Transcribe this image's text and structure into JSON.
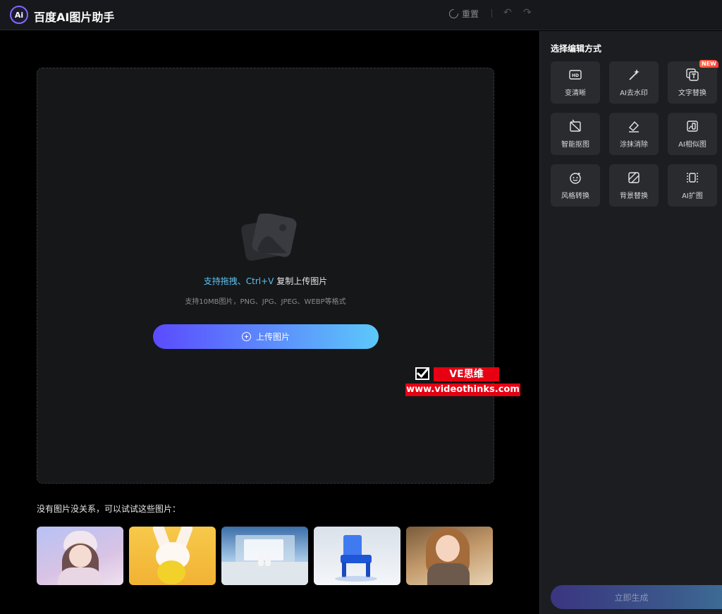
{
  "header": {
    "logo_text": "Ai",
    "title": "百度AI图片助手",
    "reset_label": "重置",
    "undo_glyph": "↶",
    "redo_glyph": "↷"
  },
  "upload": {
    "hint_highlight": "支持拖拽、Ctrl+V",
    "hint_rest": " 复制上传图片",
    "sub": "支持10MB图片，PNG、JPG、JPEG、WEBP等格式",
    "button_label": "上传图片"
  },
  "watermark": {
    "brand": "VE思维",
    "url": "www.videothinks.com"
  },
  "samples": {
    "title": "没有图片没关系，可以试试这些图片：",
    "items": [
      "girl-hat",
      "bunny",
      "pool-scene",
      "blue-chair",
      "girl-smiling"
    ]
  },
  "panel": {
    "title": "选择编辑方式",
    "tools": [
      {
        "label": "变清晰",
        "icon": "hd-icon"
      },
      {
        "label": "AI去水印",
        "icon": "magic-wand-icon"
      },
      {
        "label": "文字替换",
        "icon": "text-replace-icon",
        "badge": "NEW"
      },
      {
        "label": "智能抠图",
        "icon": "cutout-icon"
      },
      {
        "label": "涂抹消除",
        "icon": "eraser-icon"
      },
      {
        "label": "AI相似图",
        "icon": "similar-image-icon"
      },
      {
        "label": "风格转换",
        "icon": "style-icon"
      },
      {
        "label": "背景替换",
        "icon": "background-icon"
      },
      {
        "label": "AI扩图",
        "icon": "expand-icon"
      }
    ],
    "generate_label": "立即生成"
  },
  "colors": {
    "accent_start": "#5b4bff",
    "accent_end": "#5cc8fa",
    "highlight": "#5ec2f2",
    "badge": "#ff4d3d"
  }
}
